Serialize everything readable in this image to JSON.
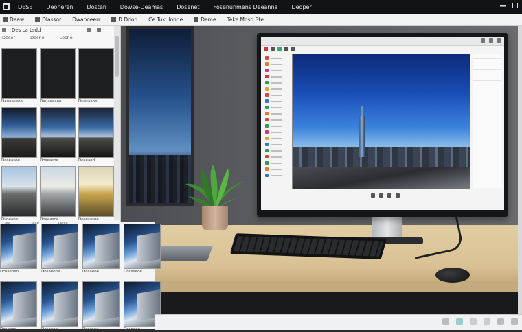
{
  "topbar": {
    "menu": [
      "DESE",
      "Deoneren",
      "Dosten",
      "Dowse-Deamas",
      "Dosenet",
      "Fosenunmens Deeanna",
      "Deoper"
    ]
  },
  "toolbar": {
    "items": [
      "Deaw",
      "Dlassor",
      "Dwaoneerr",
      "D Ddoo",
      "Ce Tuk Ilonde",
      "Deme",
      "Teke Mosd Ste"
    ]
  },
  "left_panel": {
    "title": "Des La Lsdd",
    "subtitle": [
      "Deser",
      "Desne",
      "Lesne"
    ],
    "thumbnails": [
      {
        "caption": "Dauaaseoe",
        "style": "dark"
      },
      {
        "caption": "Dauaeaaoe",
        "style": "dark"
      },
      {
        "caption": "Duasaaoe",
        "style": "dark"
      },
      {
        "caption": "Doseasoe",
        "style": "city1"
      },
      {
        "caption": "Doseasoe",
        "style": "city2"
      },
      {
        "caption": "Doseaed",
        "style": "city2"
      },
      {
        "caption": "Dsoeaoe",
        "style": "road1"
      },
      {
        "caption": "Doaeasoe",
        "style": "road2"
      },
      {
        "caption": "Dosesasoe",
        "style": "road3"
      }
    ]
  },
  "bottom_left": {
    "header": [
      "Dea",
      "Dese",
      "Dese",
      ""
    ],
    "items": [
      {
        "caption": "Dcaseoeo"
      },
      {
        "caption": "Dosaeooe"
      },
      {
        "caption": "Dosaeoe"
      },
      {
        "caption": "Dosaseoe"
      },
      {
        "caption": "Dcaoeoo"
      },
      {
        "caption": "Doseeoe"
      },
      {
        "caption": "Dosesea"
      },
      {
        "caption": "Dosoeoe"
      }
    ]
  },
  "colors": {
    "topbar_bg": "#121316",
    "accent_blue": "#1a4fb8",
    "desk": "#e2cda3"
  }
}
